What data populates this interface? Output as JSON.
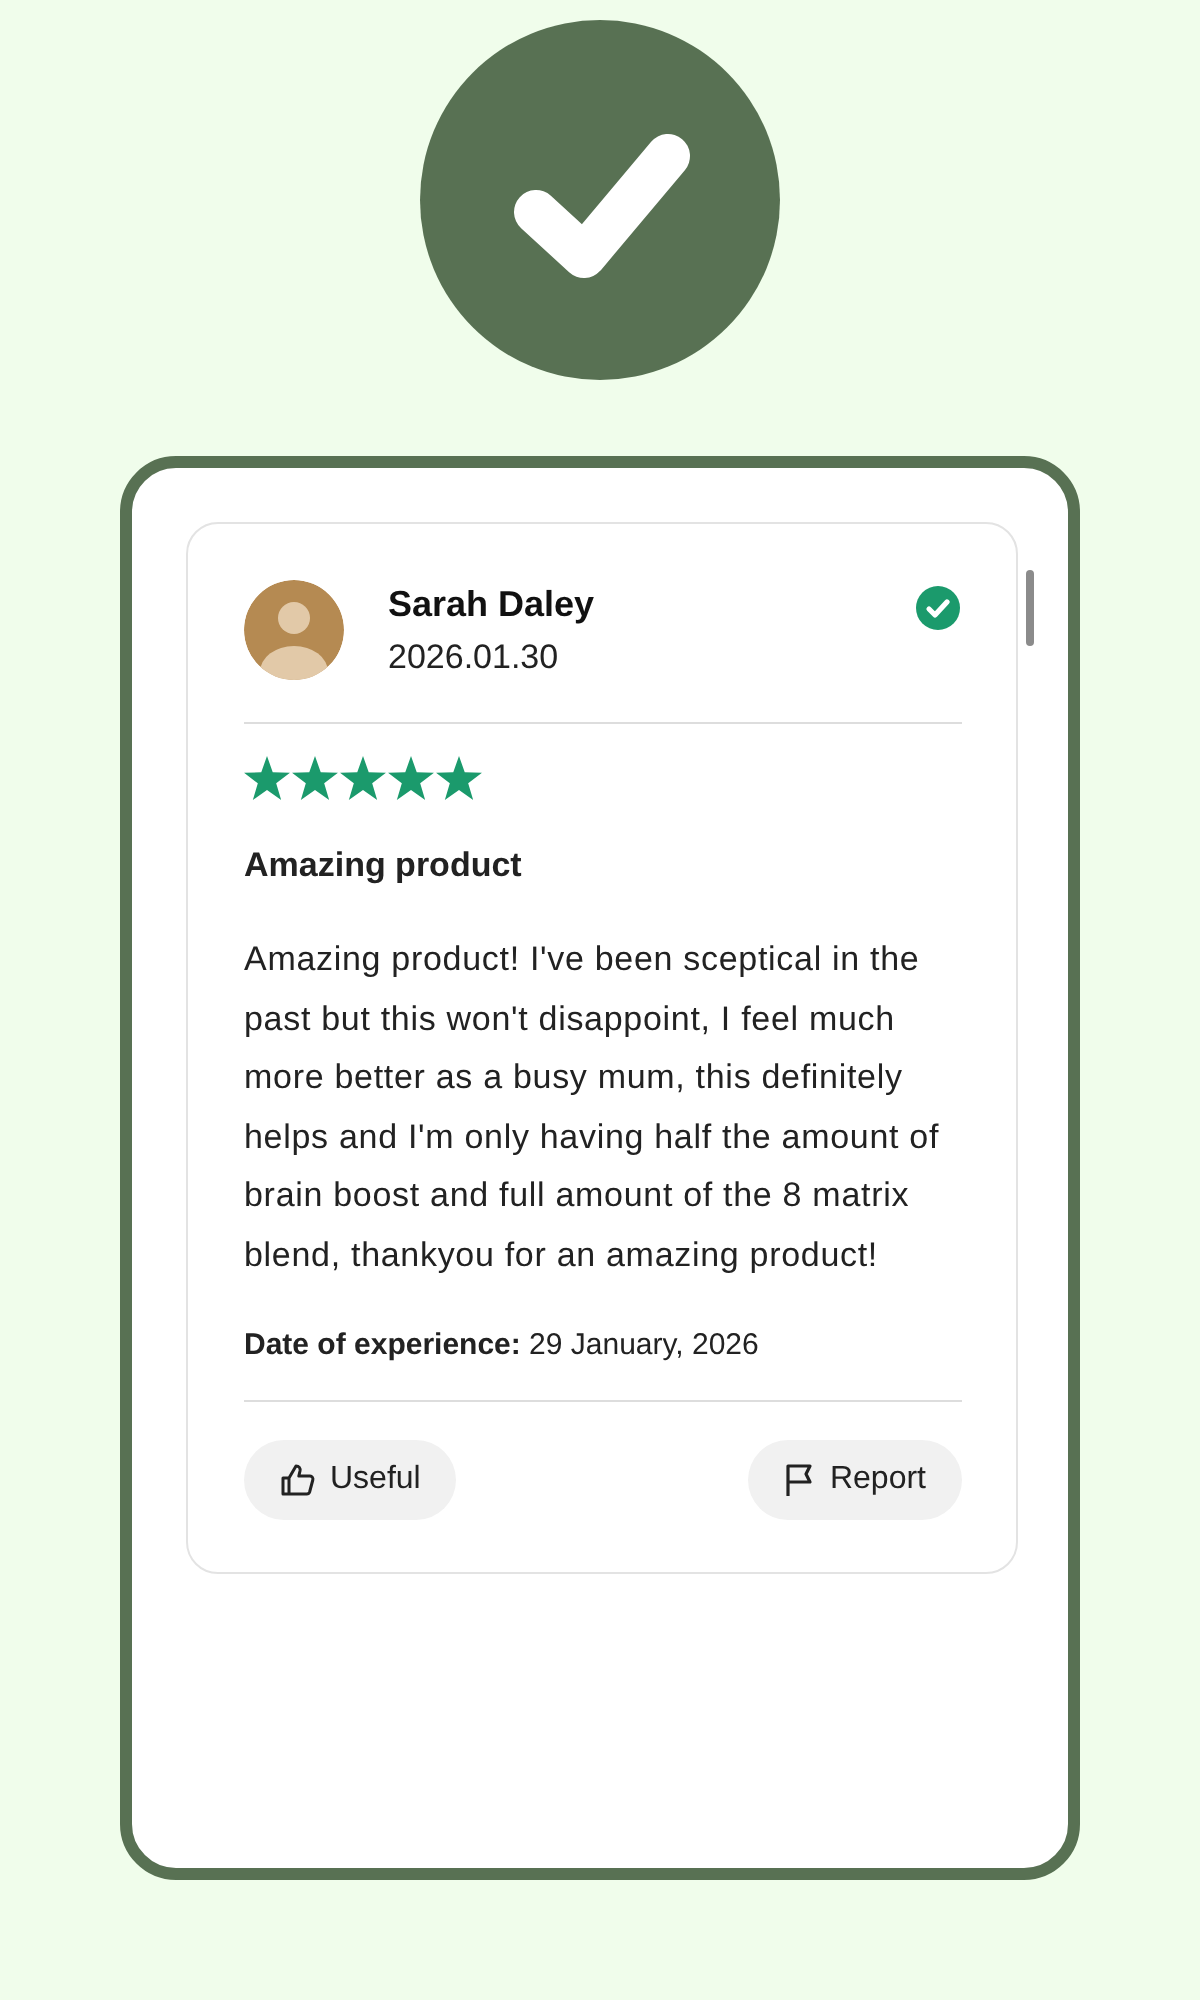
{
  "review": {
    "author": "Sarah Daley",
    "date": "2026.01.30",
    "verified": true,
    "stars": 5,
    "title": "Amazing product",
    "body": "Amazing product! I've been sceptical in the past but this won't disappoint, I feel much more better as a busy mum, this definitely helps and I'm only having half the amount of brain boost and full amount of the 8 matrix blend, thankyou for an amazing product!",
    "experience": "**Date of experience:** 29 January, 2026",
    "buttons": [
      {
        "kind": "useful",
        "label": "Useful"
      },
      {
        "kind": "report",
        "label": "Report"
      }
    ]
  }
}
